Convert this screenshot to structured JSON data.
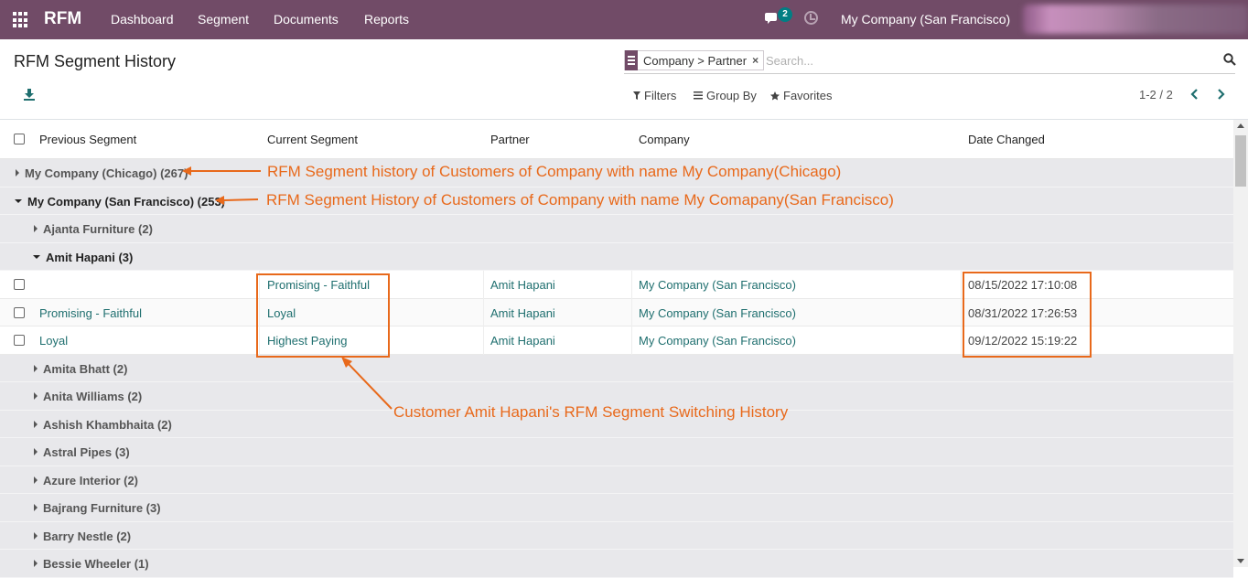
{
  "navbar": {
    "brand": "RFM",
    "menu": [
      {
        "label": "Dashboard"
      },
      {
        "label": "Segment"
      },
      {
        "label": "Documents"
      },
      {
        "label": "Reports"
      }
    ],
    "chat_count": "2",
    "company": "My Company (San Francisco)",
    "accent_color": "#714b67"
  },
  "control_panel": {
    "title": "RFM Segment History",
    "facet": "Company > Partner",
    "facet_close": "×",
    "search_placeholder": "Search...",
    "filters_label": "Filters",
    "groupby_label": "Group By",
    "favorites_label": "Favorites",
    "pager": "1-2 / 2"
  },
  "table": {
    "headers": [
      "Previous Segment",
      "Current Segment",
      "Partner",
      "Company",
      "Date Changed"
    ],
    "groups": {
      "chicago": "My Company (Chicago) (267)",
      "sanfrancisco": "My Company (San Francisco) (253)",
      "ajanta": "Ajanta Furniture (2)",
      "amit": "Amit Hapani (3)",
      "amita": "Amita Bhatt (2)",
      "anita": "Anita Williams (2)",
      "ashish": "Ashish Khambhaita (2)",
      "astral": "Astral Pipes (3)",
      "azure": "Azure Interior (2)",
      "bajrang": "Bajrang Furniture (3)",
      "barry": "Barry Nestle (2)",
      "bessie": "Bessie Wheeler (1)"
    },
    "rows": [
      {
        "previous": "",
        "current": "Promising - Faithful",
        "partner": "Amit Hapani",
        "company": "My Company (San Francisco)",
        "date": "08/15/2022 17:10:08"
      },
      {
        "previous": "Promising - Faithful",
        "current": "Loyal",
        "partner": "Amit Hapani",
        "company": "My Company (San Francisco)",
        "date": "08/31/2022 17:26:53"
      },
      {
        "previous": "Loyal",
        "current": "Highest Paying",
        "partner": "Amit Hapani",
        "company": "My Company (San Francisco)",
        "date": "09/12/2022 15:19:22"
      }
    ]
  },
  "annotations": {
    "chicago_note": "RFM Segment history of Customers of Company with name My Company(Chicago)",
    "sf_note": "RFM Segment History of Customers of Company with name My Comapany(San Francisco)",
    "switch_note": "Customer Amit Hapani's RFM Segment Switching History",
    "color": "#e8691b"
  }
}
